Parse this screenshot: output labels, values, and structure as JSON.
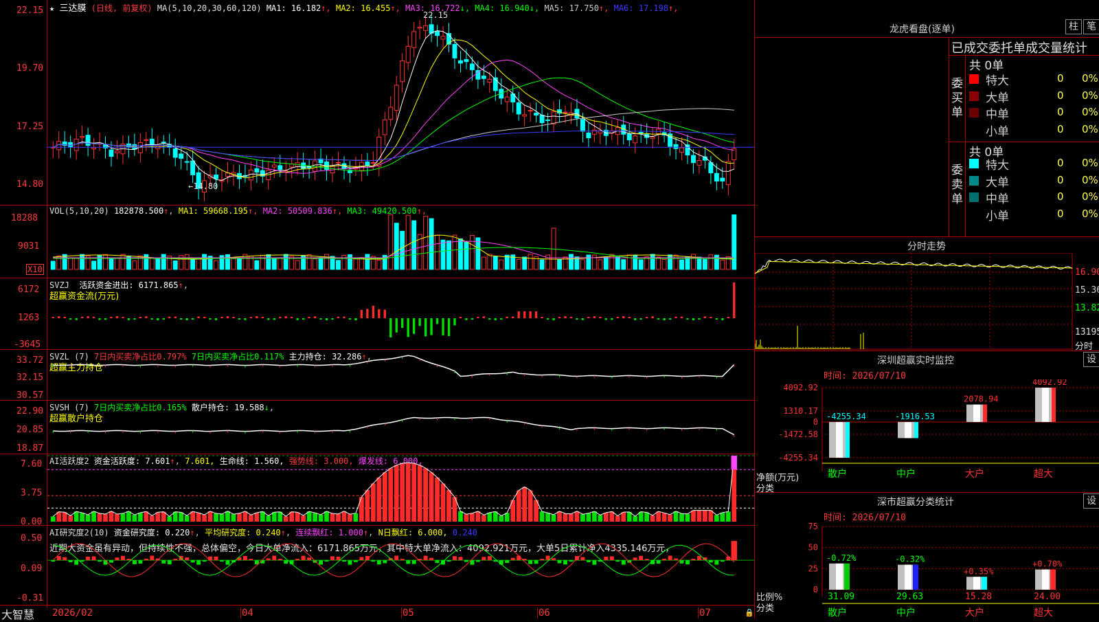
{
  "app": {
    "name": "大智慧"
  },
  "main_chart": {
    "title": "三达膜",
    "period": "(日线, 前复权)",
    "ma_params": "MA(5,10,20,30,60,120)",
    "ma": [
      {
        "label": "MA1: 16.182",
        "color": "#ffffff",
        "arrow": "↑"
      },
      {
        "label": "MA2: 16.455",
        "color": "#ffff00",
        "arrow": "↑"
      },
      {
        "label": "MA3: 16.722",
        "color": "#ff44ff",
        "arrow": "↓"
      },
      {
        "label": "MA4: 16.940",
        "color": "#00ff00",
        "arrow": "↓"
      },
      {
        "label": "MA5: 17.750",
        "color": "#cccccc",
        "arrow": "↑"
      },
      {
        "label": "MA6: 17.198",
        "color": "#3b3bff",
        "arrow": "↑"
      }
    ],
    "y_ticks": [
      "22.15",
      "19.70",
      "17.25",
      "14.80"
    ],
    "high_mark": "22.15",
    "low_mark": "←14.80"
  },
  "vol": {
    "legend_name": "VOL(5,10,20)",
    "legend_value": "182878.500",
    "ma": [
      {
        "label": "MA1: 59668.195",
        "color": "#ffff00"
      },
      {
        "label": "MA2: 50509.836",
        "color": "#ff44ff"
      },
      {
        "label": "MA3: 49420.500",
        "color": "#00ff00"
      }
    ],
    "y_ticks": [
      "18288",
      "9031"
    ],
    "unit": "X10"
  },
  "svzj": {
    "legend_name": "SVZJ",
    "legend_text": "活跃资金进出: 6171.865",
    "subtitle": "超赢资金流(万元)",
    "y_ticks": [
      "6172",
      "1263",
      "-3645"
    ]
  },
  "svzl": {
    "legend_name": "SVZL (7)",
    "l1": "7日内买卖净占比0.797%",
    "l2": "7日内买卖净占比0.117%",
    "l3": "主力持仓: 32.286",
    "subtitle": "超赢主力持仓",
    "y_ticks": [
      "33.72",
      "32.15",
      "30.57"
    ]
  },
  "svsh": {
    "legend_name": "SVSH (7)",
    "l1": "7日内买卖净占比0.165%",
    "l2": "散户持仓: 19.588",
    "subtitle": "超赢散户持仓",
    "y_ticks": [
      "22.90",
      "20.85",
      "18.87"
    ]
  },
  "ai1": {
    "legend_name": "AI活跃度2",
    "l1": "资金活跃度: 7.601",
    "l2": "7.601,",
    "l3": "生命线: 1.560,",
    "l4": "强势线: 3.000,",
    "l5": "爆发线: 6.000,",
    "y_ticks": [
      "7.60",
      "3.75",
      "0.00"
    ]
  },
  "ai2": {
    "legend_name": "AI研究度2(10)",
    "l1": "资金研究度: 0.220",
    "l2": "平均研究度: 0.240",
    "l3": "连续飘红: 1.000",
    "l4": "N日飘红: 6.000,",
    "l5": "0.240",
    "note": "近期大资金虽有异动，但持续性不强，总体偏空，今日大单净流入：6171.865万元，其中特大单净流入：4092.921万元，大单5日累计净入4335.146万元，",
    "y_ticks": [
      "0.50",
      "0.09",
      "-0.31"
    ]
  },
  "x_axis": [
    "2026/02",
    "04",
    "05",
    "06",
    "07"
  ],
  "right": {
    "lhb_title": "龙虎看盘(逐单)",
    "btn_zhu": "柱",
    "btn_bi": "笔",
    "stats_title": "已成交委托单成交量统计",
    "buy": {
      "side_label": "委买单",
      "total": "共 0单",
      "rows": [
        {
          "name": "特大",
          "count": "0",
          "pct": "0%",
          "color": "#ff0000"
        },
        {
          "name": "大单",
          "count": "0",
          "pct": "0%",
          "color": "#8b0000"
        },
        {
          "name": "中单",
          "count": "0",
          "pct": "0%",
          "color": "#6a0000"
        },
        {
          "name": "小单",
          "count": "0",
          "pct": "0%",
          "color": ""
        }
      ]
    },
    "sell": {
      "side_label": "委卖单",
      "total": "共 0单",
      "rows": [
        {
          "name": "特大",
          "count": "0",
          "pct": "0%",
          "color": "#00ffff"
        },
        {
          "name": "大单",
          "count": "0",
          "pct": "0%",
          "color": "#008b8b"
        },
        {
          "name": "中单",
          "count": "0",
          "pct": "0%",
          "color": "#007070"
        },
        {
          "name": "小单",
          "count": "0",
          "pct": "0%",
          "color": ""
        }
      ]
    },
    "intraday": {
      "title": "分时走势",
      "y_ticks": [
        "16.90",
        "15.36",
        "13.82"
      ],
      "vol_label": "13195",
      "vol_unit": "分时"
    },
    "sz_monitor": {
      "title": "深圳超赢实时监控",
      "btn": "设",
      "time": "时间: 2026/07/10",
      "y_ticks": [
        "4092.92",
        "1310.17",
        "0",
        "-1472.58",
        "-4255.34"
      ],
      "unit": "净额(万元)",
      "cat_label": "分类",
      "categories": [
        "散户",
        "中户",
        "大户",
        "超大"
      ],
      "values": [
        -4255.34,
        -1916.53,
        2078.94,
        4092.92
      ],
      "value_labels": [
        "-4255.34",
        "-1916.53",
        "2078.94",
        "4092.92"
      ]
    },
    "sz_class": {
      "title": "深市超赢分类统计",
      "btn": "设",
      "time": "时间: 2026/07/10",
      "y_ticks": [
        "75",
        "50",
        "25",
        "0"
      ],
      "unit": "比例%",
      "cat_label": "分类",
      "categories": [
        "散户",
        "中户",
        "大户",
        "超大"
      ],
      "values": [
        31.09,
        29.63,
        15.28,
        24.0
      ],
      "value_labels": [
        "31.09",
        "29.63",
        "15.28",
        "24.00"
      ],
      "changes": [
        "-0.72%",
        "-0.32%",
        "+0.35%",
        "+0.70%"
      ]
    }
  }
}
